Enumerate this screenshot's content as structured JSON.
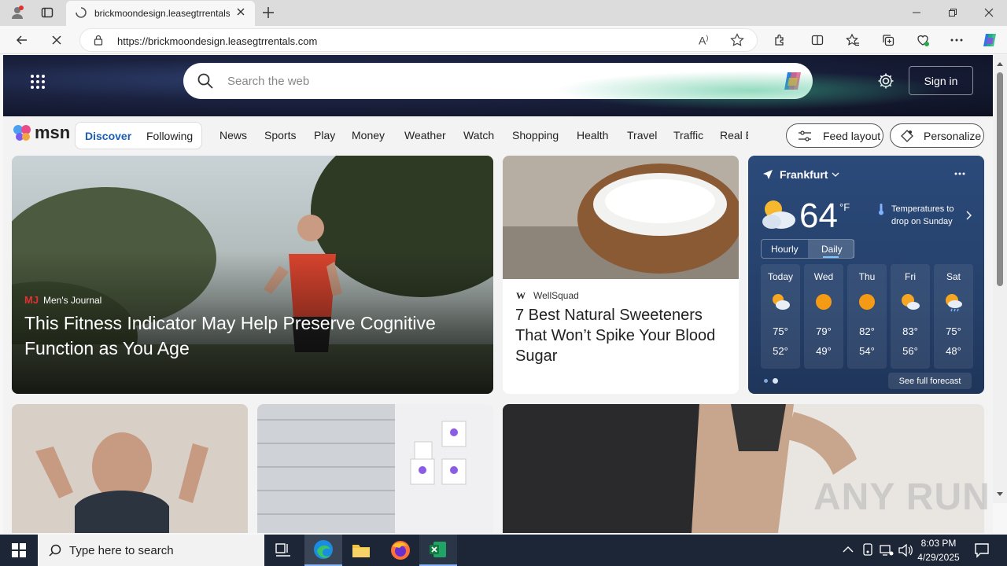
{
  "browser": {
    "tab_title": "brickmoondesign.leasegtrrentals.com",
    "url": "https://brickmoondesign.leasegtrrentals.com"
  },
  "header": {
    "search_placeholder": "Search the web",
    "sign_in_label": "Sign in"
  },
  "nav": {
    "logo_text": "msn",
    "discover_label": "Discover",
    "following_label": "Following",
    "items": [
      "News",
      "Sports",
      "Play",
      "Money",
      "Weather",
      "Watch",
      "Shopping",
      "Health",
      "Travel",
      "Traffic",
      "Real E"
    ],
    "feed_layout_label": "Feed layout",
    "personalize_label": "Personalize"
  },
  "hero_story": {
    "source_logo": "MJ",
    "source": "Men's Journal",
    "headline": "This Fitness Indicator May Help Preserve Cognitive Function as You Age"
  },
  "story_2": {
    "source_logo": "W",
    "source": "WellSquad",
    "headline": "7 Best Natural Sweeteners That Won’t Spike Your Blood Sugar"
  },
  "weather": {
    "location": "Frankfurt",
    "temperature": "64",
    "unit": "°F",
    "alert": "Temperatures to drop on Sunday",
    "tab_hourly": "Hourly",
    "tab_daily": "Daily",
    "forecast": [
      {
        "day": "Today",
        "high": "75°",
        "low": "52°",
        "icon": "partly-cloudy-icon"
      },
      {
        "day": "Wed",
        "high": "79°",
        "low": "49°",
        "icon": "sunny-icon"
      },
      {
        "day": "Thu",
        "high": "82°",
        "low": "54°",
        "icon": "sunny-icon"
      },
      {
        "day": "Fri",
        "high": "83°",
        "low": "56°",
        "icon": "partly-cloudy-icon"
      },
      {
        "day": "Sat",
        "high": "75°",
        "low": "48°",
        "icon": "rain-icon"
      }
    ],
    "see_full_label": "See full forecast"
  },
  "taskbar": {
    "search_placeholder": "Type here to search",
    "time": "8:03 PM",
    "date": "4/29/2025"
  },
  "watermark": "ANY RUN"
}
